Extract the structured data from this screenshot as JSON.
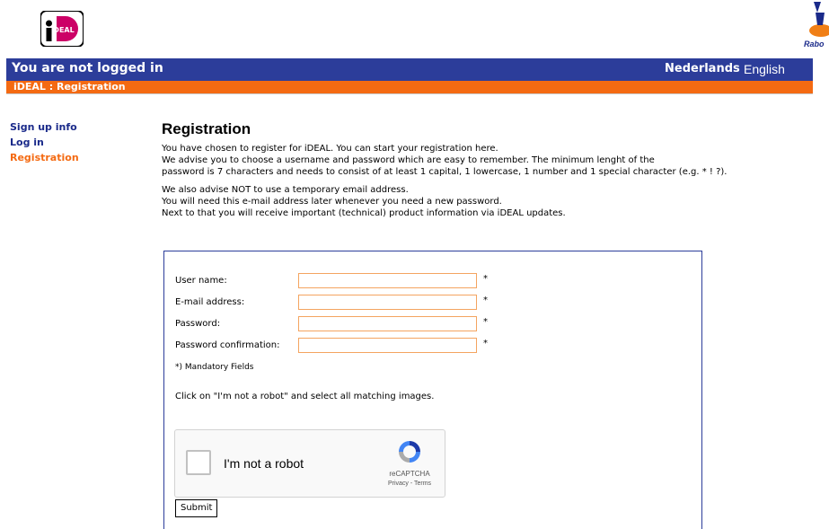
{
  "header": {
    "status_text": "You are not logged in",
    "lang_nl": "Nederlands",
    "lang_en": "English",
    "breadcrumb": "iDEAL : Registration",
    "logo_text": "iDEAL",
    "bank_logo_text": "Rabo"
  },
  "sidebar": {
    "items": [
      {
        "label": "Sign up info",
        "active": false
      },
      {
        "label": "Log in",
        "active": false
      },
      {
        "label": "Registration",
        "active": true
      }
    ]
  },
  "main": {
    "title": "Registration",
    "intro1": "You have chosen to register for iDEAL. You can start your registration here.",
    "intro2": "We advise you to choose a username and password which are easy to remember. The minimum lenght of the",
    "intro3": "password is 7 characters and needs to consist of at least 1 capital, 1 lowercase, 1 number and 1 special character (e.g. * ! ?).",
    "advise1": "We also advise NOT to use a temporary email address.",
    "advise2": "You will need this e-mail address later whenever you need a new password.",
    "advise3": "Next to that you will receive important (technical) product information via iDEAL updates."
  },
  "form": {
    "fields": [
      {
        "label": "User name:",
        "value": "",
        "required_mark": "*"
      },
      {
        "label": "E-mail address:",
        "value": "",
        "required_mark": "*"
      },
      {
        "label": "Password:",
        "value": "",
        "required_mark": "*"
      },
      {
        "label": "Password confirmation:",
        "value": "",
        "required_mark": "*"
      }
    ],
    "mandatory_note": "*) Mandatory Fields",
    "robot_instruction": "Click on \"I'm not a robot\" and select all matching images.",
    "captcha_label": "I'm not a robot",
    "captcha_brand": "reCAPTCHA",
    "captcha_links": "Privacy - Terms",
    "submit_label": "Submit"
  },
  "colors": {
    "brand_blue": "#2c3d9a",
    "accent_orange": "#f46a12",
    "ideal_pink": "#cc0066"
  }
}
